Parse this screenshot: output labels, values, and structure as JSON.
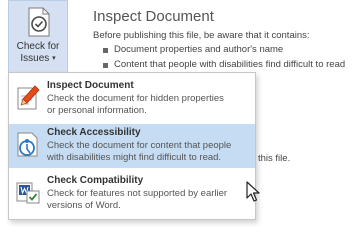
{
  "check_for_issues": {
    "label_line1": "Check for",
    "label_line2": "Issues",
    "caret": "▾",
    "icon": "document-checkmark-icon"
  },
  "inspect_panel": {
    "title": "Inspect Document",
    "description": "Before publishing this file, be aware that it contains:",
    "bullets": [
      "Document properties and author's name",
      "Content that people with disabilities find difficult to read"
    ],
    "partial_text": "this file."
  },
  "menu": {
    "items": [
      {
        "title": "Inspect Document",
        "desc_line1": "Check the document for hidden properties",
        "desc_line2": "or personal information.",
        "icon": "inspect-pen-icon"
      },
      {
        "title": "Check Accessibility",
        "desc_line1": "Check the document for content that people",
        "desc_line2": "with disabilities might find difficult to read.",
        "icon": "accessibility-icon"
      },
      {
        "title": "Check Compatibility",
        "desc_line1": "Check for features not supported by earlier",
        "desc_line2": "versions of Word.",
        "icon": "compatibility-icon"
      }
    ],
    "highlighted_index": 1
  },
  "colors": {
    "button_bg": "#d5e1f2",
    "highlight_bg": "#c5dcf2",
    "word_blue": "#2b579a"
  }
}
